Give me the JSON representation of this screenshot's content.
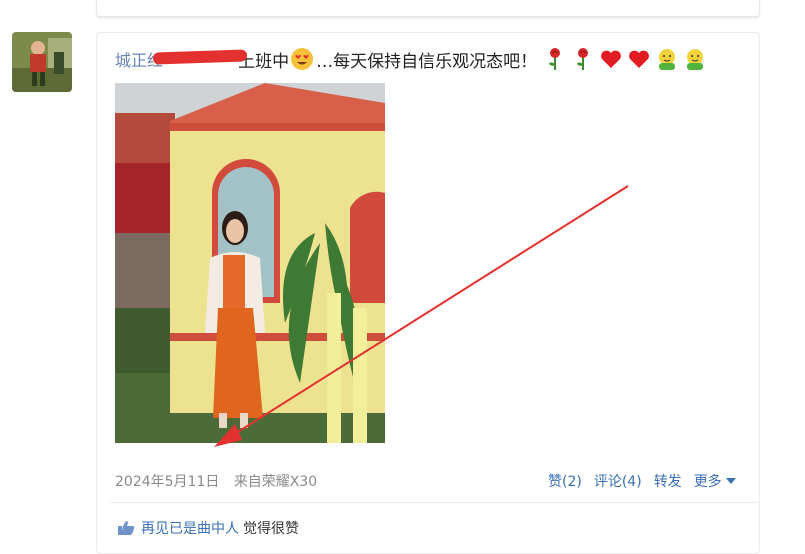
{
  "post": {
    "username": "城正红",
    "text": "上班中",
    "text_after": "…每天保持自信乐观况态吧！",
    "emoji_icons": [
      "heart-eyes-emoji-icon",
      "rose-icon",
      "rose-icon",
      "red-heart-icon",
      "red-heart-icon",
      "hug-emoji-icon",
      "hug-emoji-icon"
    ]
  },
  "meta": {
    "date": "2024年5月11日",
    "source": "来自荣耀X30"
  },
  "actions": {
    "like": "赞(2)",
    "comment": "评论(4)",
    "repost": "转发",
    "more": "更多"
  },
  "likes": {
    "user": "再见已是曲中人",
    "text": "觉得很赞"
  },
  "colors": {
    "link": "#3b6fb6",
    "annotation_red": "#e3312f"
  }
}
